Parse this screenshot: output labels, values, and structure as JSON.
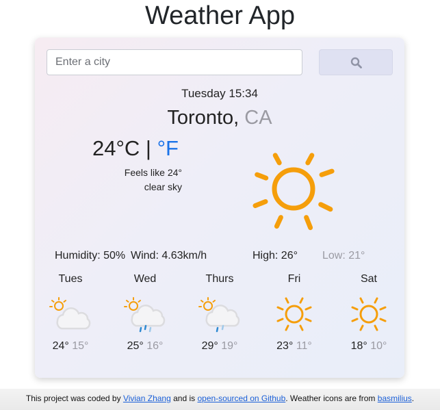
{
  "app": {
    "title": "Weather App"
  },
  "search": {
    "placeholder": "Enter a city",
    "value": ""
  },
  "current": {
    "datetime": "Tuesday 15:34",
    "city": "Toronto,",
    "country": "CA",
    "temp": "24",
    "unit_c": "°C",
    "separator": "|",
    "unit_f": "°F",
    "feels_like": "Feels like 24°",
    "description": "clear sky",
    "icon": "sun-icon",
    "humidity": "Humidity: 50%",
    "wind": "Wind: 4.63km/h",
    "high": "High: 26°",
    "low": "Low: 21°"
  },
  "forecast": [
    {
      "day": "Tues",
      "high": "24°",
      "low": "15°",
      "icon": "partly-cloudy-icon"
    },
    {
      "day": "Wed",
      "high": "25°",
      "low": "16°",
      "icon": "partly-cloudy-rain-icon"
    },
    {
      "day": "Thurs",
      "high": "29°",
      "low": "19°",
      "icon": "partly-cloudy-rain-icon"
    },
    {
      "day": "Fri",
      "high": "23°",
      "low": "11°",
      "icon": "sun-icon"
    },
    {
      "day": "Sat",
      "high": "18°",
      "low": "10°",
      "icon": "sun-icon"
    }
  ],
  "footer": {
    "text1": "This project was coded by",
    "author": "Vivian Zhang",
    "text2": "and is",
    "repo": "open-sourced on Github",
    "text3": ". Weather icons are from",
    "icons_credit": "basmilius",
    "text4": "."
  },
  "colors": {
    "accent": "#1a73e8",
    "sun": "#f59e0b",
    "muted": "#9a9aa2",
    "rain": "#2e8ad1"
  }
}
